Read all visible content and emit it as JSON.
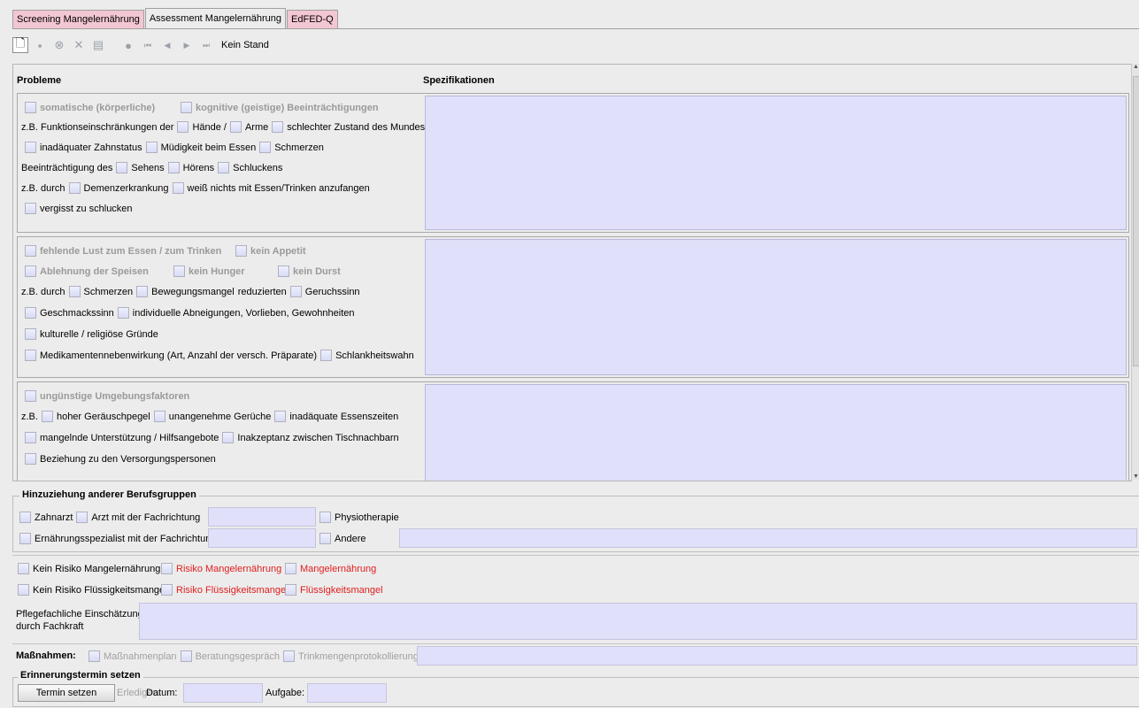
{
  "tabs": [
    {
      "label": "Screening Mangelernährung"
    },
    {
      "label": "Assessment Mangelernährung"
    },
    {
      "label": "EdFED-Q"
    }
  ],
  "toolbar": {
    "icons": [
      "new-document-icon",
      "save-icon",
      "cancel-icon",
      "delete-icon",
      "print-icon",
      "record-icon",
      "first-icon",
      "previous-icon",
      "next-icon",
      "last-icon"
    ],
    "status_text": "Kein Stand"
  },
  "columns": {
    "problems": "Probleme",
    "specs": "Spezifikationen"
  },
  "group1": {
    "somatic": "somatische (körperliche)",
    "cognitive": "kognitive (geistige) Beeinträchtigungen",
    "row2_prefix": "z.B. Funktionseinschränkungen der",
    "haende": "Hände /",
    "arme": "Arme",
    "mund": "schlechter Zustand des Mundes",
    "zahnstatus": "inadäquater Zahnstatus",
    "muedigkeit": "Müdigkeit beim Essen",
    "schmerzen": "Schmerzen",
    "row4_prefix": "Beeinträchtigung des",
    "sehens": "Sehens",
    "hoerens": "Hörens",
    "schluckens": "Schluckens",
    "row5_prefix": "z.B. durch",
    "demenz": "Demenzerkrankung",
    "weiss_nicht": "weiß nichts mit Essen/Trinken anzufangen",
    "vergisst": "vergisst zu schlucken"
  },
  "group2": {
    "lust": "fehlende Lust zum Essen / zum Trinken",
    "appetit": "kein Appetit",
    "ablehnung": "Ablehnung der Speisen",
    "hunger": "kein Hunger",
    "durst": "kein Durst",
    "row3_prefix": "z.B. durch",
    "schmerzen": "Schmerzen",
    "bewegung": "Bewegungsmangel",
    "reduzierten": "reduzierten",
    "geruch": "Geruchssinn",
    "geschmack": "Geschmackssinn",
    "abneigungen": "individuelle Abneigungen, Vorlieben, Gewohnheiten",
    "kulturell": "kulturelle / religiöse Gründe",
    "medikamente": "Medikamentennebenwirkung (Art, Anzahl der versch. Präparate)",
    "schlankheit": "Schlankheitswahn"
  },
  "group3": {
    "umgebung": "ungünstige Umgebungsfaktoren",
    "row2_prefix": "z.B.",
    "geraeusch": "hoher Geräuschpegel",
    "gerueche": "unangenehme Gerüche",
    "essenszeiten": "inadäquate Essenszeiten",
    "unterstuetzung": "mangelnde Unterstützung / Hilfsangebote",
    "inakzeptanz": "Inakzeptanz zwischen Tischnachbarn",
    "beziehung": "Beziehung zu den Versorgungspersonen"
  },
  "berufsgruppen": {
    "title": "Hinzuziehung anderer Berufsgruppen",
    "zahnarzt": "Zahnarzt",
    "arzt": "Arzt mit der Fachrichtung",
    "physio": "Physiotherapie",
    "ernaehrung": "Ernährungsspezialist mit der Fachrichtung",
    "andere": "Andere"
  },
  "risk": {
    "kein_risiko_mangel": "Kein Risiko Mangelernährung",
    "risiko_mangel": "Risiko Mangelernährung",
    "mangel": "Mangelernährung",
    "kein_risiko_fluessig": "Kein Risiko Flüssigkeitsmangel",
    "risiko_fluessig": "Risiko Flüssigkeitsmangel",
    "fluessig": "Flüssigkeitsmangel",
    "red_color": "#e11d1d"
  },
  "assessment": {
    "label_line1": "Pflegefachliche Einschätzung",
    "label_line2": "durch Fachkraft"
  },
  "massnahmen": {
    "label": "Maßnahmen:",
    "plan": "Maßnahmenplan",
    "beratung": "Beratungsgespräch",
    "trink": "Trinkmengenprotokollierung"
  },
  "reminder": {
    "title": "Erinnerungstermin setzen",
    "termin_button": "Termin setzen",
    "erledigen": "Erledigen",
    "datum": "Datum:",
    "aufgabe": "Aufgabe:"
  }
}
